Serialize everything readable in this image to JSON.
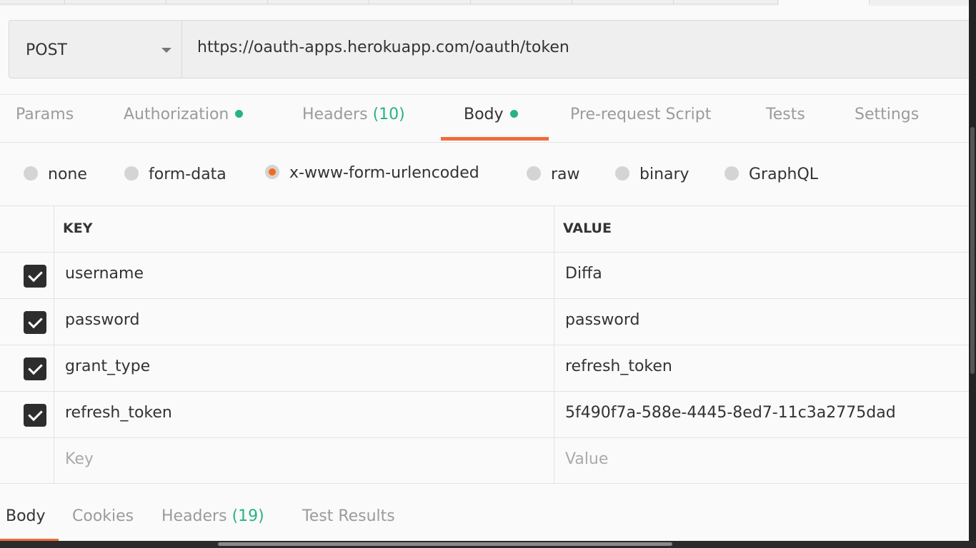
{
  "request": {
    "method": "POST",
    "url": "https://oauth-apps.herokuapp.com/oauth/token"
  },
  "tabs": [
    {
      "label": "Params"
    },
    {
      "label": "Authorization",
      "status": "green-dot"
    },
    {
      "label": "Headers",
      "count": "(10)"
    },
    {
      "label": "Body",
      "status": "green-dot",
      "active": true
    },
    {
      "label": "Pre-request Script"
    },
    {
      "label": "Tests"
    },
    {
      "label": "Settings"
    }
  ],
  "body_types": [
    {
      "label": "none"
    },
    {
      "label": "form-data"
    },
    {
      "label": "x-www-form-urlencoded",
      "selected": true
    },
    {
      "label": "raw"
    },
    {
      "label": "binary"
    },
    {
      "label": "GraphQL"
    }
  ],
  "table": {
    "headers": {
      "key": "KEY",
      "value": "VALUE"
    },
    "rows": [
      {
        "key": "username",
        "value": "Diffa",
        "checked": true
      },
      {
        "key": "password",
        "value": "password",
        "checked": true
      },
      {
        "key": "grant_type",
        "value": "refresh_token",
        "checked": true
      },
      {
        "key": "refresh_token",
        "value": "5f490f7a-588e-4445-8ed7-11c3a2775dad",
        "checked": true
      }
    ],
    "placeholder": {
      "key": "Key",
      "value": "Value"
    }
  },
  "response_tabs": [
    {
      "label": "Body",
      "active": true
    },
    {
      "label": "Cookies"
    },
    {
      "label": "Headers",
      "count": "(19)"
    },
    {
      "label": "Test Results"
    }
  ],
  "colors": {
    "accent": "#f26b3a",
    "status_green": "#26b47f"
  }
}
